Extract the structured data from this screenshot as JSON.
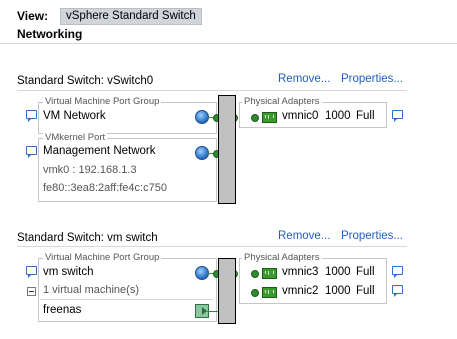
{
  "header": {
    "view_label": "View:",
    "view_value": "vSphere Standard Switch",
    "section_title": "Networking"
  },
  "switches": [
    {
      "title": "Standard Switch: vSwitch0",
      "remove_label": "Remove...",
      "properties_label": "Properties...",
      "vm_port_group": {
        "caption": "Virtual Machine Port Group",
        "name": "VM Network"
      },
      "vmkernel_port": {
        "caption": "VMkernel Port",
        "name": "Management Network",
        "ipv4": "vmk0 : 192.168.1.3",
        "ipv6": "fe80::3ea8:2aff:fe4c:c750"
      },
      "physical_adapters": {
        "caption": "Physical Adapters",
        "adapters": [
          {
            "name": "vmnic0",
            "speed": "1000",
            "duplex": "Full"
          }
        ]
      }
    },
    {
      "title": "Standard Switch: vm switch",
      "remove_label": "Remove...",
      "properties_label": "Properties...",
      "vm_port_group": {
        "caption": "Virtual Machine Port Group",
        "name": "vm switch",
        "vm_count": "1 virtual machine(s)",
        "vm_name": "freenas"
      },
      "physical_adapters": {
        "caption": "Physical Adapters",
        "adapters": [
          {
            "name": "vmnic3",
            "speed": "1000",
            "duplex": "Full"
          },
          {
            "name": "vmnic2",
            "speed": "1000",
            "duplex": "Full"
          }
        ]
      }
    }
  ],
  "colors": {
    "link": "#1f5fbf",
    "connector": "#2e8b2e",
    "bus_fill": "#c0c0c0",
    "view_select_bg": "#d0d4db"
  },
  "icons": [
    "speech-bubble-icon",
    "globe-icon",
    "network-adapter-icon",
    "virtual-machine-icon",
    "collapse-icon"
  ]
}
